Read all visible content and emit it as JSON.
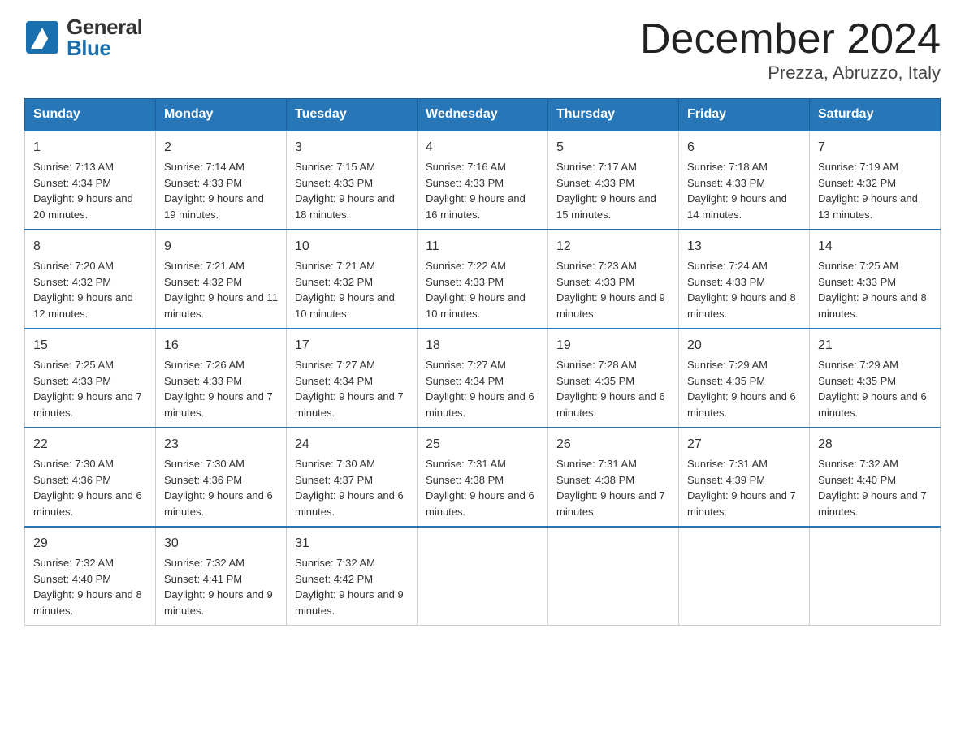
{
  "logo": {
    "line1": "General",
    "line2": "Blue"
  },
  "title": "December 2024",
  "subtitle": "Prezza, Abruzzo, Italy",
  "days_of_week": [
    "Sunday",
    "Monday",
    "Tuesday",
    "Wednesday",
    "Thursday",
    "Friday",
    "Saturday"
  ],
  "weeks": [
    [
      {
        "day": "1",
        "sunrise": "Sunrise: 7:13 AM",
        "sunset": "Sunset: 4:34 PM",
        "daylight": "Daylight: 9 hours and 20 minutes."
      },
      {
        "day": "2",
        "sunrise": "Sunrise: 7:14 AM",
        "sunset": "Sunset: 4:33 PM",
        "daylight": "Daylight: 9 hours and 19 minutes."
      },
      {
        "day": "3",
        "sunrise": "Sunrise: 7:15 AM",
        "sunset": "Sunset: 4:33 PM",
        "daylight": "Daylight: 9 hours and 18 minutes."
      },
      {
        "day": "4",
        "sunrise": "Sunrise: 7:16 AM",
        "sunset": "Sunset: 4:33 PM",
        "daylight": "Daylight: 9 hours and 16 minutes."
      },
      {
        "day": "5",
        "sunrise": "Sunrise: 7:17 AM",
        "sunset": "Sunset: 4:33 PM",
        "daylight": "Daylight: 9 hours and 15 minutes."
      },
      {
        "day": "6",
        "sunrise": "Sunrise: 7:18 AM",
        "sunset": "Sunset: 4:33 PM",
        "daylight": "Daylight: 9 hours and 14 minutes."
      },
      {
        "day": "7",
        "sunrise": "Sunrise: 7:19 AM",
        "sunset": "Sunset: 4:32 PM",
        "daylight": "Daylight: 9 hours and 13 minutes."
      }
    ],
    [
      {
        "day": "8",
        "sunrise": "Sunrise: 7:20 AM",
        "sunset": "Sunset: 4:32 PM",
        "daylight": "Daylight: 9 hours and 12 minutes."
      },
      {
        "day": "9",
        "sunrise": "Sunrise: 7:21 AM",
        "sunset": "Sunset: 4:32 PM",
        "daylight": "Daylight: 9 hours and 11 minutes."
      },
      {
        "day": "10",
        "sunrise": "Sunrise: 7:21 AM",
        "sunset": "Sunset: 4:32 PM",
        "daylight": "Daylight: 9 hours and 10 minutes."
      },
      {
        "day": "11",
        "sunrise": "Sunrise: 7:22 AM",
        "sunset": "Sunset: 4:33 PM",
        "daylight": "Daylight: 9 hours and 10 minutes."
      },
      {
        "day": "12",
        "sunrise": "Sunrise: 7:23 AM",
        "sunset": "Sunset: 4:33 PM",
        "daylight": "Daylight: 9 hours and 9 minutes."
      },
      {
        "day": "13",
        "sunrise": "Sunrise: 7:24 AM",
        "sunset": "Sunset: 4:33 PM",
        "daylight": "Daylight: 9 hours and 8 minutes."
      },
      {
        "day": "14",
        "sunrise": "Sunrise: 7:25 AM",
        "sunset": "Sunset: 4:33 PM",
        "daylight": "Daylight: 9 hours and 8 minutes."
      }
    ],
    [
      {
        "day": "15",
        "sunrise": "Sunrise: 7:25 AM",
        "sunset": "Sunset: 4:33 PM",
        "daylight": "Daylight: 9 hours and 7 minutes."
      },
      {
        "day": "16",
        "sunrise": "Sunrise: 7:26 AM",
        "sunset": "Sunset: 4:33 PM",
        "daylight": "Daylight: 9 hours and 7 minutes."
      },
      {
        "day": "17",
        "sunrise": "Sunrise: 7:27 AM",
        "sunset": "Sunset: 4:34 PM",
        "daylight": "Daylight: 9 hours and 7 minutes."
      },
      {
        "day": "18",
        "sunrise": "Sunrise: 7:27 AM",
        "sunset": "Sunset: 4:34 PM",
        "daylight": "Daylight: 9 hours and 6 minutes."
      },
      {
        "day": "19",
        "sunrise": "Sunrise: 7:28 AM",
        "sunset": "Sunset: 4:35 PM",
        "daylight": "Daylight: 9 hours and 6 minutes."
      },
      {
        "day": "20",
        "sunrise": "Sunrise: 7:29 AM",
        "sunset": "Sunset: 4:35 PM",
        "daylight": "Daylight: 9 hours and 6 minutes."
      },
      {
        "day": "21",
        "sunrise": "Sunrise: 7:29 AM",
        "sunset": "Sunset: 4:35 PM",
        "daylight": "Daylight: 9 hours and 6 minutes."
      }
    ],
    [
      {
        "day": "22",
        "sunrise": "Sunrise: 7:30 AM",
        "sunset": "Sunset: 4:36 PM",
        "daylight": "Daylight: 9 hours and 6 minutes."
      },
      {
        "day": "23",
        "sunrise": "Sunrise: 7:30 AM",
        "sunset": "Sunset: 4:36 PM",
        "daylight": "Daylight: 9 hours and 6 minutes."
      },
      {
        "day": "24",
        "sunrise": "Sunrise: 7:30 AM",
        "sunset": "Sunset: 4:37 PM",
        "daylight": "Daylight: 9 hours and 6 minutes."
      },
      {
        "day": "25",
        "sunrise": "Sunrise: 7:31 AM",
        "sunset": "Sunset: 4:38 PM",
        "daylight": "Daylight: 9 hours and 6 minutes."
      },
      {
        "day": "26",
        "sunrise": "Sunrise: 7:31 AM",
        "sunset": "Sunset: 4:38 PM",
        "daylight": "Daylight: 9 hours and 7 minutes."
      },
      {
        "day": "27",
        "sunrise": "Sunrise: 7:31 AM",
        "sunset": "Sunset: 4:39 PM",
        "daylight": "Daylight: 9 hours and 7 minutes."
      },
      {
        "day": "28",
        "sunrise": "Sunrise: 7:32 AM",
        "sunset": "Sunset: 4:40 PM",
        "daylight": "Daylight: 9 hours and 7 minutes."
      }
    ],
    [
      {
        "day": "29",
        "sunrise": "Sunrise: 7:32 AM",
        "sunset": "Sunset: 4:40 PM",
        "daylight": "Daylight: 9 hours and 8 minutes."
      },
      {
        "day": "30",
        "sunrise": "Sunrise: 7:32 AM",
        "sunset": "Sunset: 4:41 PM",
        "daylight": "Daylight: 9 hours and 9 minutes."
      },
      {
        "day": "31",
        "sunrise": "Sunrise: 7:32 AM",
        "sunset": "Sunset: 4:42 PM",
        "daylight": "Daylight: 9 hours and 9 minutes."
      },
      null,
      null,
      null,
      null
    ]
  ]
}
